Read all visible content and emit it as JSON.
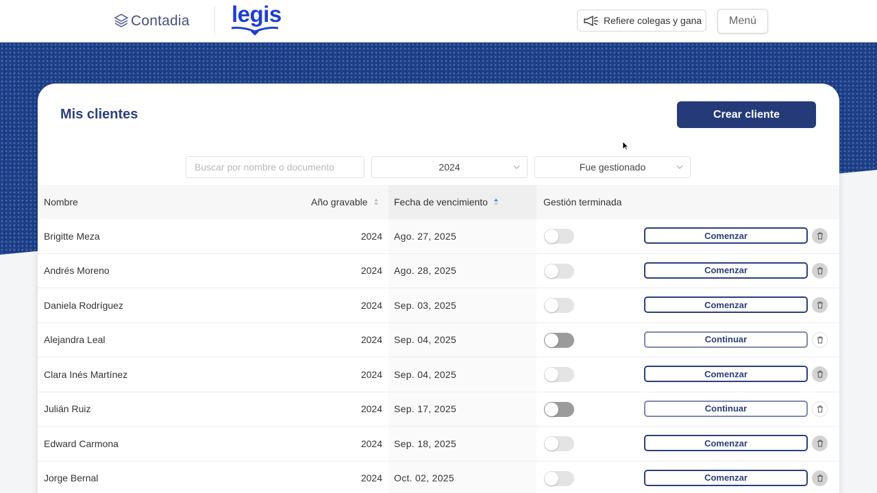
{
  "header": {
    "brand": "Contadia",
    "partner_brand": "legis",
    "refer_label": "Refiere colegas y gana",
    "menu_label": "Menú"
  },
  "main": {
    "title": "Mis clientes",
    "create_label": "Crear cliente",
    "search_placeholder": "Buscar por nombre o documento",
    "year_filter": "2024",
    "status_filter": "Fue gestionado"
  },
  "table": {
    "columns": {
      "name": "Nombre",
      "year": "Año gravable",
      "due": "Fecha de vencimiento",
      "done": "Gestión terminada"
    },
    "rows": [
      {
        "name": "Brigitte Meza",
        "year": "2024",
        "due": "Ago. 27, 2025",
        "toggle": false,
        "action": "Comenzar",
        "toggle_style": "light"
      },
      {
        "name": "Andrés Moreno",
        "year": "2024",
        "due": "Ago. 28, 2025",
        "toggle": false,
        "action": "Comenzar",
        "toggle_style": "light"
      },
      {
        "name": "Daniela Rodríguez",
        "year": "2024",
        "due": "Sep. 03, 2025",
        "toggle": false,
        "action": "Comenzar",
        "toggle_style": "light"
      },
      {
        "name": "Alejandra Leal",
        "year": "2024",
        "due": "Sep. 04, 2025",
        "toggle": false,
        "action": "Continuar",
        "toggle_style": "dark"
      },
      {
        "name": "Clara Inés Martínez",
        "year": "2024",
        "due": "Sep. 04, 2025",
        "toggle": false,
        "action": "Comenzar",
        "toggle_style": "light"
      },
      {
        "name": "Julián Ruiz",
        "year": "2024",
        "due": "Sep. 17, 2025",
        "toggle": false,
        "action": "Continuar",
        "toggle_style": "dark"
      },
      {
        "name": "Edward Carmona",
        "year": "2024",
        "due": "Sep. 18, 2025",
        "toggle": false,
        "action": "Comenzar",
        "toggle_style": "light"
      },
      {
        "name": "Jorge Bernal",
        "year": "2024",
        "due": "Oct. 02, 2025",
        "toggle": false,
        "action": "Comenzar",
        "toggle_style": "light"
      }
    ]
  },
  "colors": {
    "primary": "#253a78",
    "hero": "#1e3f86",
    "legis_blue": "#1d3fcf"
  }
}
